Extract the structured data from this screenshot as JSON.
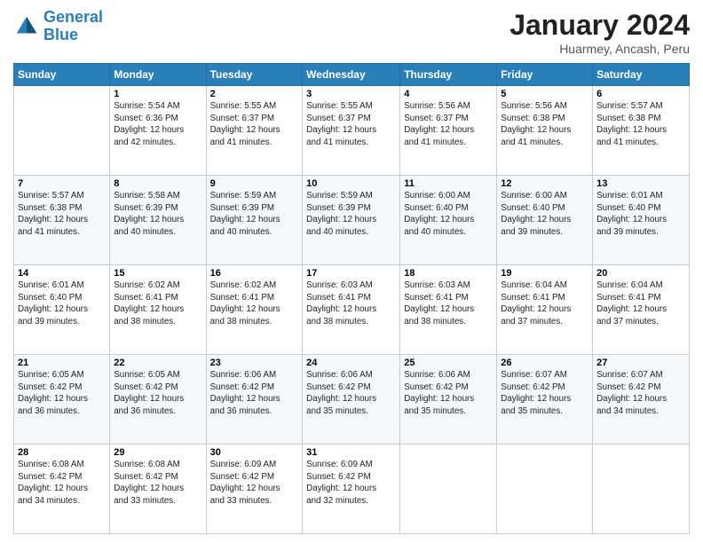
{
  "logo": {
    "line1": "General",
    "line2": "Blue"
  },
  "header": {
    "title": "January 2024",
    "location": "Huarmey, Ancash, Peru"
  },
  "days_of_week": [
    "Sunday",
    "Monday",
    "Tuesday",
    "Wednesday",
    "Thursday",
    "Friday",
    "Saturday"
  ],
  "weeks": [
    [
      {
        "day": "",
        "info": ""
      },
      {
        "day": "1",
        "info": "Sunrise: 5:54 AM\nSunset: 6:36 PM\nDaylight: 12 hours\nand 42 minutes."
      },
      {
        "day": "2",
        "info": "Sunrise: 5:55 AM\nSunset: 6:37 PM\nDaylight: 12 hours\nand 41 minutes."
      },
      {
        "day": "3",
        "info": "Sunrise: 5:55 AM\nSunset: 6:37 PM\nDaylight: 12 hours\nand 41 minutes."
      },
      {
        "day": "4",
        "info": "Sunrise: 5:56 AM\nSunset: 6:37 PM\nDaylight: 12 hours\nand 41 minutes."
      },
      {
        "day": "5",
        "info": "Sunrise: 5:56 AM\nSunset: 6:38 PM\nDaylight: 12 hours\nand 41 minutes."
      },
      {
        "day": "6",
        "info": "Sunrise: 5:57 AM\nSunset: 6:38 PM\nDaylight: 12 hours\nand 41 minutes."
      }
    ],
    [
      {
        "day": "7",
        "info": "Sunrise: 5:57 AM\nSunset: 6:38 PM\nDaylight: 12 hours\nand 41 minutes."
      },
      {
        "day": "8",
        "info": "Sunrise: 5:58 AM\nSunset: 6:39 PM\nDaylight: 12 hours\nand 40 minutes."
      },
      {
        "day": "9",
        "info": "Sunrise: 5:59 AM\nSunset: 6:39 PM\nDaylight: 12 hours\nand 40 minutes."
      },
      {
        "day": "10",
        "info": "Sunrise: 5:59 AM\nSunset: 6:39 PM\nDaylight: 12 hours\nand 40 minutes."
      },
      {
        "day": "11",
        "info": "Sunrise: 6:00 AM\nSunset: 6:40 PM\nDaylight: 12 hours\nand 40 minutes."
      },
      {
        "day": "12",
        "info": "Sunrise: 6:00 AM\nSunset: 6:40 PM\nDaylight: 12 hours\nand 39 minutes."
      },
      {
        "day": "13",
        "info": "Sunrise: 6:01 AM\nSunset: 6:40 PM\nDaylight: 12 hours\nand 39 minutes."
      }
    ],
    [
      {
        "day": "14",
        "info": "Sunrise: 6:01 AM\nSunset: 6:40 PM\nDaylight: 12 hours\nand 39 minutes."
      },
      {
        "day": "15",
        "info": "Sunrise: 6:02 AM\nSunset: 6:41 PM\nDaylight: 12 hours\nand 38 minutes."
      },
      {
        "day": "16",
        "info": "Sunrise: 6:02 AM\nSunset: 6:41 PM\nDaylight: 12 hours\nand 38 minutes."
      },
      {
        "day": "17",
        "info": "Sunrise: 6:03 AM\nSunset: 6:41 PM\nDaylight: 12 hours\nand 38 minutes."
      },
      {
        "day": "18",
        "info": "Sunrise: 6:03 AM\nSunset: 6:41 PM\nDaylight: 12 hours\nand 38 minutes."
      },
      {
        "day": "19",
        "info": "Sunrise: 6:04 AM\nSunset: 6:41 PM\nDaylight: 12 hours\nand 37 minutes."
      },
      {
        "day": "20",
        "info": "Sunrise: 6:04 AM\nSunset: 6:41 PM\nDaylight: 12 hours\nand 37 minutes."
      }
    ],
    [
      {
        "day": "21",
        "info": "Sunrise: 6:05 AM\nSunset: 6:42 PM\nDaylight: 12 hours\nand 36 minutes."
      },
      {
        "day": "22",
        "info": "Sunrise: 6:05 AM\nSunset: 6:42 PM\nDaylight: 12 hours\nand 36 minutes."
      },
      {
        "day": "23",
        "info": "Sunrise: 6:06 AM\nSunset: 6:42 PM\nDaylight: 12 hours\nand 36 minutes."
      },
      {
        "day": "24",
        "info": "Sunrise: 6:06 AM\nSunset: 6:42 PM\nDaylight: 12 hours\nand 35 minutes."
      },
      {
        "day": "25",
        "info": "Sunrise: 6:06 AM\nSunset: 6:42 PM\nDaylight: 12 hours\nand 35 minutes."
      },
      {
        "day": "26",
        "info": "Sunrise: 6:07 AM\nSunset: 6:42 PM\nDaylight: 12 hours\nand 35 minutes."
      },
      {
        "day": "27",
        "info": "Sunrise: 6:07 AM\nSunset: 6:42 PM\nDaylight: 12 hours\nand 34 minutes."
      }
    ],
    [
      {
        "day": "28",
        "info": "Sunrise: 6:08 AM\nSunset: 6:42 PM\nDaylight: 12 hours\nand 34 minutes."
      },
      {
        "day": "29",
        "info": "Sunrise: 6:08 AM\nSunset: 6:42 PM\nDaylight: 12 hours\nand 33 minutes."
      },
      {
        "day": "30",
        "info": "Sunrise: 6:09 AM\nSunset: 6:42 PM\nDaylight: 12 hours\nand 33 minutes."
      },
      {
        "day": "31",
        "info": "Sunrise: 6:09 AM\nSunset: 6:42 PM\nDaylight: 12 hours\nand 32 minutes."
      },
      {
        "day": "",
        "info": ""
      },
      {
        "day": "",
        "info": ""
      },
      {
        "day": "",
        "info": ""
      }
    ]
  ]
}
